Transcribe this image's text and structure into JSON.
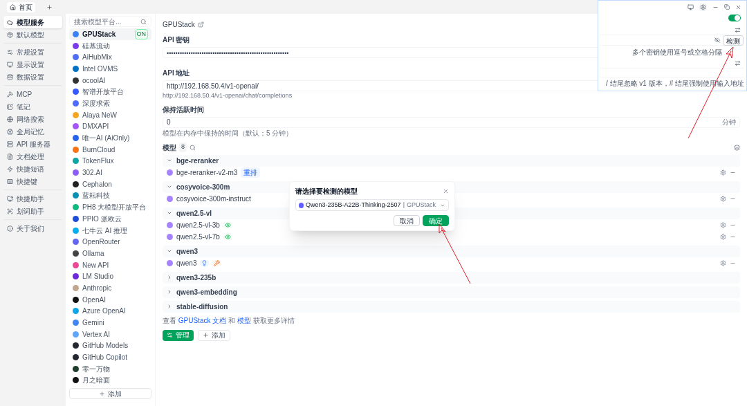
{
  "tabs": [
    {
      "label": "首页",
      "selected": true
    }
  ],
  "sidebar": {
    "sections": [
      [
        {
          "label": "模型服务",
          "selected": true
        },
        {
          "label": "默认模型",
          "selected": false
        }
      ],
      [
        {
          "label": "常规设置",
          "selected": false
        },
        {
          "label": "显示设置",
          "selected": false
        },
        {
          "label": "数据设置",
          "selected": false
        }
      ],
      [
        {
          "label": "MCP",
          "selected": false
        },
        {
          "label": "笔记",
          "selected": false
        },
        {
          "label": "网络搜索",
          "selected": false
        },
        {
          "label": "全局记忆",
          "selected": false
        },
        {
          "label": "API 服务器",
          "selected": false
        },
        {
          "label": "文档处理",
          "selected": false
        },
        {
          "label": "快捷短语",
          "selected": false
        },
        {
          "label": "快捷键",
          "selected": false
        }
      ],
      [
        {
          "label": "快捷助手",
          "selected": false
        },
        {
          "label": "划词助手",
          "selected": false
        }
      ],
      [
        {
          "label": "关于我们",
          "selected": false
        }
      ]
    ]
  },
  "providers": {
    "search": {
      "placeholder": "搜索模型平台..."
    },
    "items": [
      {
        "name": "GPUStack",
        "selected": true,
        "badge": "ON",
        "color": "#3b82f6"
      },
      {
        "name": "硅基流动",
        "selected": false,
        "color": "#7c3aed"
      },
      {
        "name": "AiHubMix",
        "selected": false,
        "color": "#4f6ef7"
      },
      {
        "name": "Intel OVMS",
        "selected": false,
        "color": "#0071c5"
      },
      {
        "name": "ocoolAI",
        "selected": false,
        "color": "#333333"
      },
      {
        "name": "智谱开放平台",
        "selected": false,
        "color": "#3859ff"
      },
      {
        "name": "深度求索",
        "selected": false,
        "color": "#4d6bfe"
      },
      {
        "name": "Alaya NeW",
        "selected": false,
        "color": "#f5a623"
      },
      {
        "name": "DMXAPI",
        "selected": false,
        "color": "#a855f7"
      },
      {
        "name": "唯一AI (AiOnly)",
        "selected": false,
        "color": "#2563eb"
      },
      {
        "name": "BurnCloud",
        "selected": false,
        "color": "#f97316"
      },
      {
        "name": "TokenFlux",
        "selected": false,
        "color": "#0ea5a4"
      },
      {
        "name": "302.AI",
        "selected": false,
        "color": "#8b5cf6"
      },
      {
        "name": "Cephalon",
        "selected": false,
        "color": "#222222"
      },
      {
        "name": "蓝耘科技",
        "selected": false,
        "color": "#0891b2"
      },
      {
        "name": "PH8 大模型开放平台",
        "selected": false,
        "color": "#10b981"
      },
      {
        "name": "PPIO 派欧云",
        "selected": false,
        "color": "#1d4ed8"
      },
      {
        "name": "七牛云 AI 推理",
        "selected": false,
        "color": "#06aeef"
      },
      {
        "name": "OpenRouter",
        "selected": false,
        "color": "#6366f1"
      },
      {
        "name": "Ollama",
        "selected": false,
        "color": "#444444"
      },
      {
        "name": "New API",
        "selected": false,
        "color": "#ec4899"
      },
      {
        "name": "LM Studio",
        "selected": false,
        "color": "#6d28d9"
      },
      {
        "name": "Anthropic",
        "selected": false,
        "color": "#c2a68c"
      },
      {
        "name": "OpenAI",
        "selected": false,
        "color": "#111111"
      },
      {
        "name": "Azure OpenAI",
        "selected": false,
        "color": "#0ea5e9"
      },
      {
        "name": "Gemini",
        "selected": false,
        "color": "#4285f4"
      },
      {
        "name": "Vertex AI",
        "selected": false,
        "color": "#60a5fa"
      },
      {
        "name": "GitHub Models",
        "selected": false,
        "color": "#24292f"
      },
      {
        "name": "GitHub Copilot",
        "selected": false,
        "color": "#24292f"
      },
      {
        "name": "零一万物",
        "selected": false,
        "color": "#1f3d2b"
      },
      {
        "name": "月之暗面",
        "selected": false,
        "color": "#111111"
      }
    ],
    "add_button": "添加"
  },
  "detail": {
    "title": "GPUStack",
    "api_key": {
      "label": "API 密钥",
      "value": "••••••••••••••••••••••••••••••••••••••••••••••••••••••••"
    },
    "api_url": {
      "label": "API 地址",
      "value": "http://192.168.50.4/v1-openai/",
      "hint": "http://192.168.50.4/v1-openai/chat/completions"
    },
    "keep_alive": {
      "label": "保持活跃时间",
      "value": "0",
      "unit": "分钟",
      "hint": "模型在内存中保持的时间（默认：5 分钟）"
    },
    "models": {
      "label": "模型",
      "count": "8",
      "groups": [
        {
          "name": "bge-reranker",
          "expanded": true,
          "models": [
            {
              "name": "bge-reranker-v2-m3",
              "tags": [
                {
                  "kind": "rerank",
                  "label": "重排"
                }
              ]
            }
          ]
        },
        {
          "name": "cosyvoice-300m",
          "expanded": true,
          "models": [
            {
              "name": "cosyvoice-300m-instruct"
            }
          ]
        },
        {
          "name": "qwen2.5-vl",
          "expanded": true,
          "models": [
            {
              "name": "qwen2.5-vl-3b",
              "tags": [
                {
                  "kind": "vision"
                }
              ]
            },
            {
              "name": "qwen2.5-vl-7b",
              "tags": [
                {
                  "kind": "vision"
                }
              ]
            }
          ]
        },
        {
          "name": "qwen3",
          "expanded": true,
          "models": [
            {
              "name": "qwen3",
              "tags": [
                {
                  "kind": "reasoning"
                },
                {
                  "kind": "tool"
                }
              ]
            }
          ]
        },
        {
          "name": "qwen3-235b",
          "expanded": false
        },
        {
          "name": "qwen3-embedding",
          "expanded": false
        },
        {
          "name": "stable-diffusion",
          "expanded": false
        }
      ]
    },
    "footer": [
      {
        "text": "查看",
        "link": false
      },
      {
        "text": "GPUStack 文档",
        "link": true
      },
      {
        "text": "和",
        "link": false
      },
      {
        "text": "模型",
        "link": true
      },
      {
        "text": "获取更多详情",
        "link": false
      }
    ],
    "buttons": [
      {
        "label": "管理",
        "kind": "primary"
      },
      {
        "label": "添加",
        "kind": "secondary"
      }
    ]
  },
  "dialog": {
    "title": "请选择要检测的模型",
    "model": "Qwen3-235B-A22B-Thinking-2507",
    "separator": "|",
    "provider": "GPUStack",
    "buttons": [
      {
        "label": "取消",
        "kind": "secondary"
      },
      {
        "label": "确定",
        "kind": "primary"
      }
    ]
  },
  "inset": {
    "enabled": true,
    "check_button": "检测",
    "key_hint": "多个密钥使用逗号或空格分隔",
    "url_hint": "/ 结尾忽略 v1 版本，# 结尾强制使用输入地址"
  }
}
